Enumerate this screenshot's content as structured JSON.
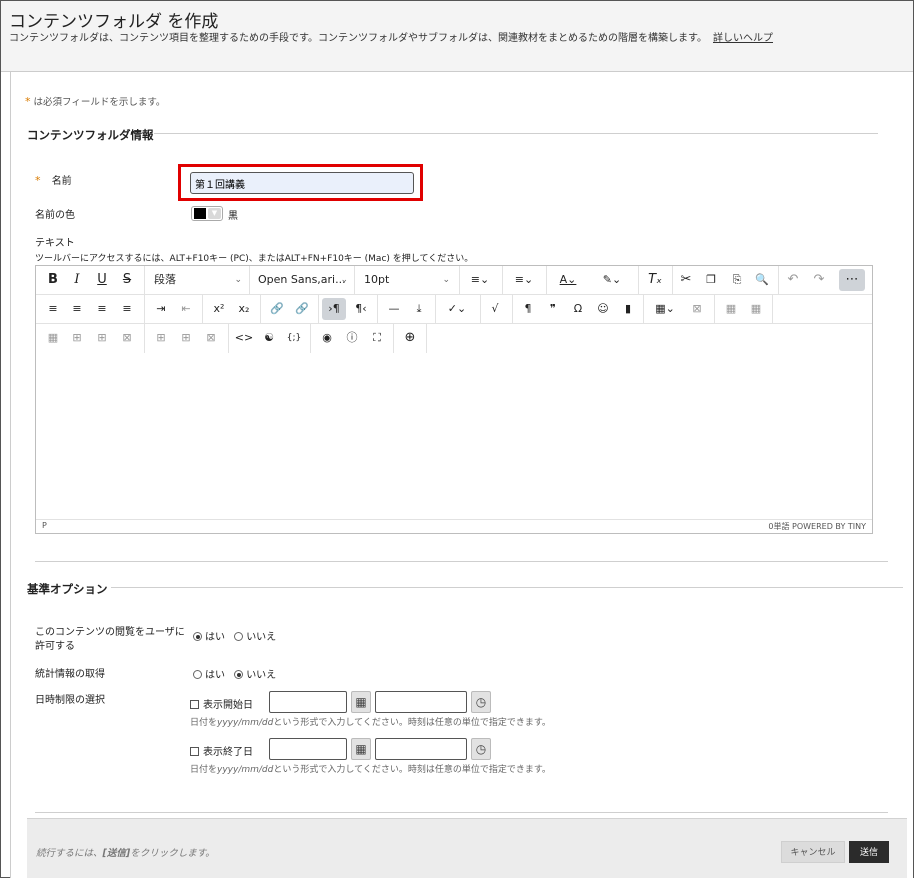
{
  "header": {
    "title": "コンテンツフォルダ を作成",
    "description": "コンテンツフォルダは、コンテンツ項目を整理するための手段です。コンテンツフォルダやサブフォルダは、関連教材をまとめるための階層を構築します。",
    "help_link": "詳しいヘルプ"
  },
  "required_note": {
    "star": "*",
    "text": "は必須フィールドを示します。"
  },
  "folder_info": {
    "section_title": "コンテンツフォルダ情報",
    "name_label": "名前",
    "name_value": "第１回講義",
    "name_color_label": "名前の色",
    "name_color_value": "黒",
    "name_color_hex": "#000000",
    "text_label": "テキスト",
    "toolbar_hint": "ツールバーにアクセスするには、ALT+F10キー (PC)、またはALT+FN+F10キー (Mac) を押してください。"
  },
  "editor": {
    "paragraph_select": "段落",
    "font_select": "Open Sans,ari...",
    "size_select": "10pt",
    "status_left": "P",
    "status_right": "0単語  POWERED BY TINY"
  },
  "standard_options": {
    "section_title": "基準オプション",
    "allow_view_label_1": "このコンテンツの閲覧をユーザに",
    "allow_view_label_2": "許可する",
    "allow_yes": "はい",
    "allow_no": "いいえ",
    "tracking_label": "統計情報の取得",
    "tracking_yes": "はい",
    "tracking_no": "いいえ",
    "date_restrict_label": "日時制限の選択",
    "display_after_label": "表示開始日",
    "display_until_label": "表示終了日",
    "date_hint_prefix": "日付を",
    "date_hint_format": "yyyy/mm/dd",
    "date_hint_suffix": "という形式で入力してください。時刻は任意の単位で指定できます。"
  },
  "footer": {
    "instruction_prefix": "続行するには、",
    "instruction_bold": "[送信]",
    "instruction_suffix": "をクリックします。",
    "cancel_label": "キャンセル",
    "submit_label": "送信"
  },
  "colors": {
    "highlight_border": "#e00000",
    "required_star": "#d97b00",
    "submit_bg": "#2b2b2b"
  }
}
